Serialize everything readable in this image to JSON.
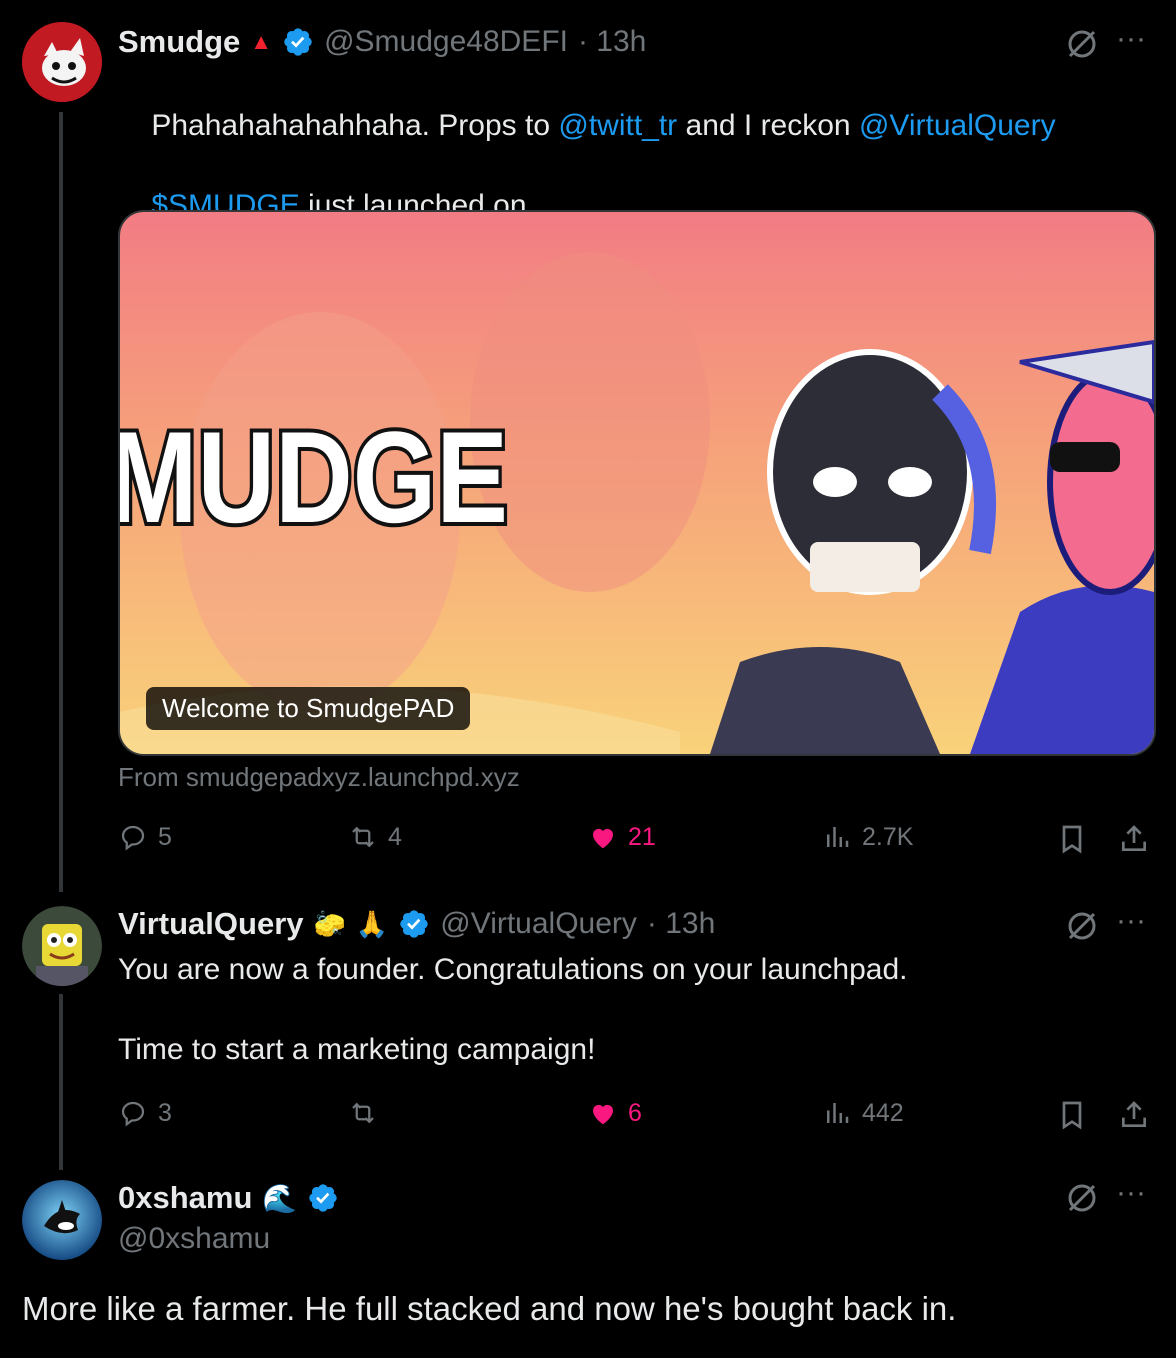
{
  "tweet1": {
    "name": "Smudge",
    "handle": "@Smudge48DEFI",
    "time": "· 13h",
    "line1_prefix": "Phahahahahahhaha. Props to ",
    "mention1": "@twitt_tr",
    "line1_mid": " and I reckon ",
    "mention2": "@VirtualQuery",
    "cashtag": "$SMUDGE",
    "line2_rest": " just launched on",
    "card": {
      "brand_text": "MUDGE",
      "caption": "Welcome to SmudgePAD"
    },
    "from": "From smudgepadxyz.launchpd.xyz",
    "replies": "5",
    "retweets": "4",
    "likes": "21",
    "views": "2.7K"
  },
  "tweet2": {
    "name": "VirtualQuery",
    "handle": "@VirtualQuery",
    "time": "· 13h",
    "line1": "You are now a founder. Congratulations on your launchpad.",
    "line2": "Time to start a marketing campaign!",
    "replies": "3",
    "likes": "6",
    "views": "442"
  },
  "tweet3": {
    "name": "0xshamu",
    "handle": "@0xshamu",
    "text": "More like a farmer. He full stacked and now he's bought back in."
  },
  "colors": {
    "accent": "#1d9bf0",
    "like": "#f91880",
    "muted": "#71767b"
  },
  "icons": [
    "reply-icon",
    "retweet-icon",
    "heart-icon",
    "views-icon",
    "bookmark-icon",
    "share-icon",
    "grok-icon",
    "more-icon",
    "verified-icon"
  ]
}
